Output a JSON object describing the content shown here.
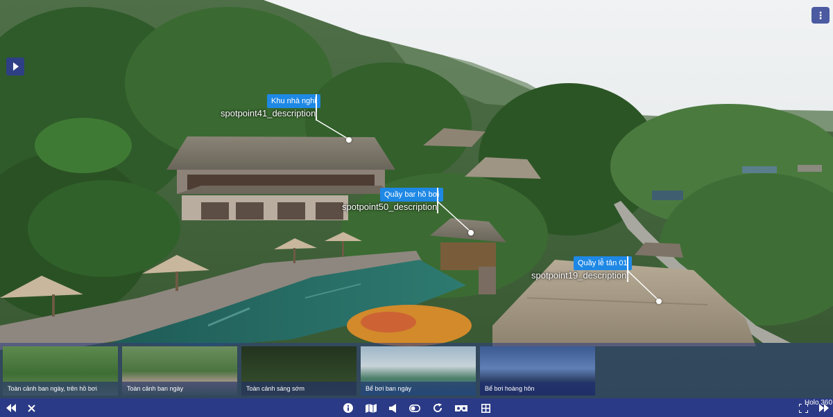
{
  "hotspots": [
    {
      "id": "spotpoint41",
      "title": "Khu nhà nghỉ",
      "description": "spotpoint41_description"
    },
    {
      "id": "spotpoint50",
      "title": "Quầy bar hồ bơi",
      "description": "spotpoint50_description"
    },
    {
      "id": "spotpoint19",
      "title": "Quầy lễ tân 01",
      "description": "spotpoint19_description"
    }
  ],
  "thumbnails": [
    {
      "label": "Toàn cảnh ban ngày, trên hồ bơi",
      "selected": false
    },
    {
      "label": "Toàn cảnh ban ngày",
      "selected": false
    },
    {
      "label": "Toàn cảnh sáng sớm",
      "selected": false
    },
    {
      "label": "Bể bơi ban ngày",
      "selected": false
    },
    {
      "label": "Bể bơi hoàng hôn",
      "selected": false
    }
  ],
  "toolbar": {
    "left": [
      "rewind-icon",
      "close-icon"
    ],
    "center": [
      "info-icon",
      "map-icon",
      "sound-icon",
      "toggle-icon",
      "rotate-icon",
      "vr-icon",
      "gallery-icon"
    ],
    "right": [
      "fullscreen-icon",
      "fast-forward-icon"
    ]
  },
  "brand": "Holo 360",
  "colors": {
    "toolbar_bg": "#2b3a86",
    "hotspot_title_bg": "#1e88e5",
    "menu_button_bg": "#4b5aa1"
  }
}
